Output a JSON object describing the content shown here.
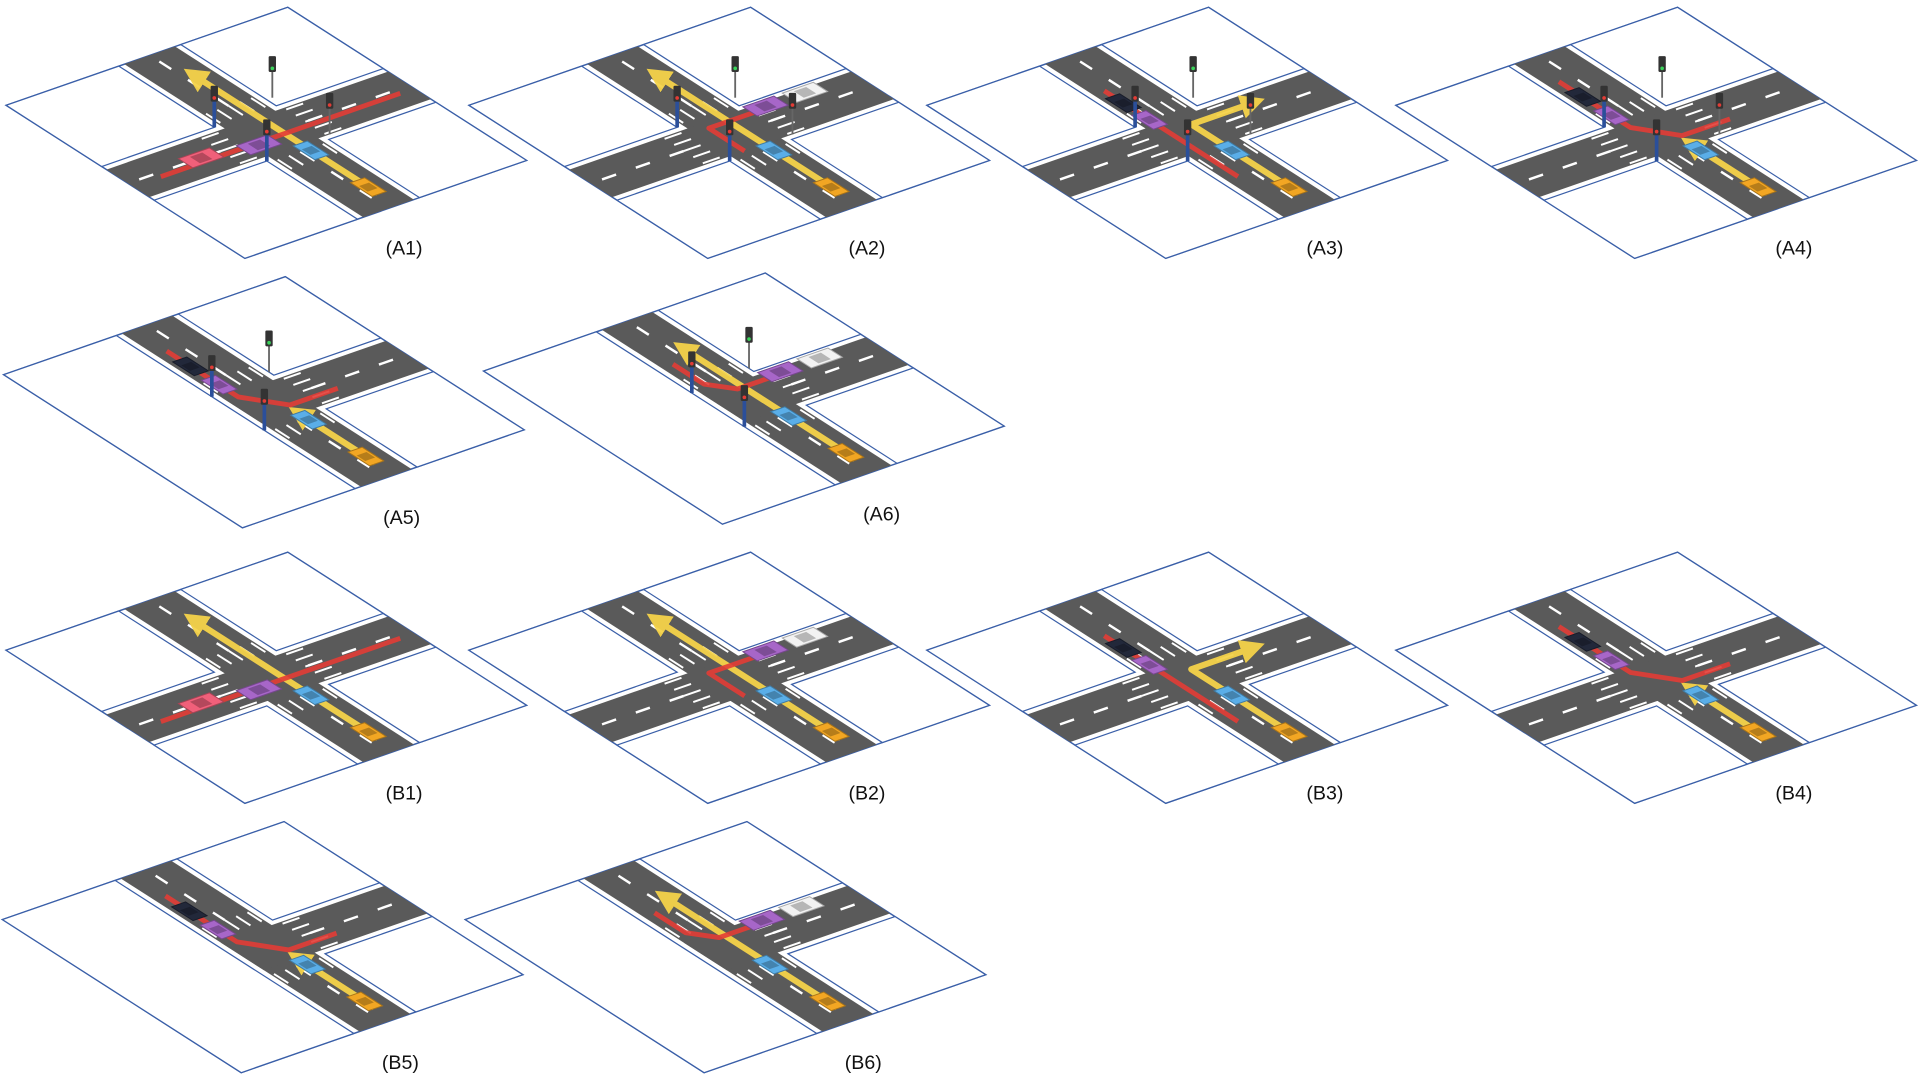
{
  "figure": {
    "colors": {
      "plane_border": "#3a5fa8",
      "road": "#5a5a5a",
      "marking": "#ffffff",
      "path_straight": "#f5d34a",
      "path_conflict": "#e23c35",
      "signal_pole": "#2b4f9a"
    },
    "panels": [
      {
        "label": "(A1)",
        "intersection": "4-way",
        "signals": true,
        "vehicles": [
          "#f0607a",
          "#a766c8",
          "#5aaee8",
          "#f2a623"
        ]
      },
      {
        "label": "(A2)",
        "intersection": "4-way",
        "signals": true,
        "vehicles": [
          "#a766c8",
          "#f2f2f2",
          "#5aaee8",
          "#f2a623"
        ]
      },
      {
        "label": "(A3)",
        "intersection": "4-way",
        "signals": true,
        "vehicles": [
          "#22283a",
          "#a766c8",
          "#5aaee8",
          "#f2a623"
        ]
      },
      {
        "label": "(A4)",
        "intersection": "4-way",
        "signals": true,
        "vehicles": [
          "#22283a",
          "#a766c8",
          "#5aaee8",
          "#f2a623"
        ]
      },
      {
        "label": "(A5)",
        "intersection": "T-junction",
        "signals": true,
        "vehicles": [
          "#22283a",
          "#a766c8",
          "#5aaee8",
          "#f2a623"
        ]
      },
      {
        "label": "(A6)",
        "intersection": "T-junction",
        "signals": true,
        "vehicles": [
          "#a766c8",
          "#f2f2f2",
          "#5aaee8",
          "#f2a623"
        ]
      },
      {
        "label": "(B1)",
        "intersection": "4-way",
        "signals": false,
        "vehicles": [
          "#f0607a",
          "#a766c8",
          "#5aaee8",
          "#f2a623"
        ]
      },
      {
        "label": "(B2)",
        "intersection": "4-way",
        "signals": false,
        "vehicles": [
          "#a766c8",
          "#f2f2f2",
          "#5aaee8",
          "#f2a623"
        ]
      },
      {
        "label": "(B3)",
        "intersection": "4-way",
        "signals": false,
        "vehicles": [
          "#22283a",
          "#a766c8",
          "#5aaee8",
          "#f2a623"
        ]
      },
      {
        "label": "(B4)",
        "intersection": "4-way",
        "signals": false,
        "vehicles": [
          "#22283a",
          "#a766c8",
          "#5aaee8",
          "#f2a623"
        ]
      },
      {
        "label": "(B5)",
        "intersection": "T-junction",
        "signals": false,
        "vehicles": [
          "#22283a",
          "#a766c8",
          "#5aaee8",
          "#f2a623"
        ]
      },
      {
        "label": "(B6)",
        "intersection": "T-junction",
        "signals": false,
        "vehicles": [
          "#a766c8",
          "#f2f2f2",
          "#5aaee8",
          "#f2a623"
        ]
      }
    ]
  }
}
